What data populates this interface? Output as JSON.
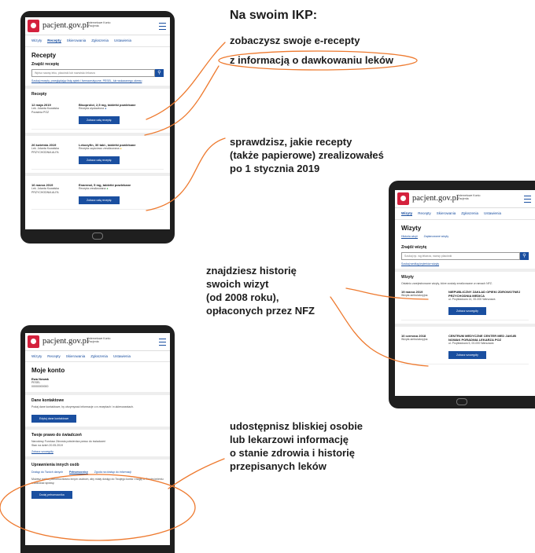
{
  "annotations": {
    "title": "Na swoim IKP:",
    "ann1_line1": "zobaczysz swoje e-recepty",
    "ann1_line2": "z informacją o dawkowaniu leków",
    "ann2": [
      "sprawdzisz, jakie recepty",
      "(także papierowe) zrealizowałeś",
      "po 1 stycznia 2019"
    ],
    "ann3": [
      "znajdziesz historię",
      "swoich wizyt",
      "(od 2008 roku),",
      "opłaconych przez NFZ"
    ],
    "ann4": [
      "udostępnisz bliskiej osobie",
      "lub lekarzowi informację",
      "o stanie zdrowia i historię",
      "przepisanych leków"
    ]
  },
  "site": {
    "brand": "pacjent.gov.pl",
    "brand_sub": "Internetowe Konto Pacjenta",
    "nav": [
      "Wizyty",
      "Recepty",
      "Skierowania",
      "Zgłoszenia",
      "Ustawienia"
    ]
  },
  "recepty": {
    "title": "Recepty",
    "search_label": "Znajdź receptę",
    "search_placeholder": "Wpisz nazwę leku, placówki lub nazwisko lekarza",
    "search_link": "Szukaj recepty, przeglądając listę aptek i farmaceutyczne, PESEL, lub wskazanego okresu",
    "list_title": "Recepty",
    "items": [
      {
        "date": "12 maja 2019",
        "meta1": "Lek. Jolanta Kowalska",
        "meta2": "Poradnia POZ",
        "drug": "Bisoprolol, 2,5 mg, tabletki powlekane",
        "status": "Recepta wystawiona",
        "button": "Zobacz całą receptę"
      },
      {
        "date": "26 kwietnia 2019",
        "meta1": "Lek. Jolanta Kowalska",
        "meta2": "PRZYCHODNIA ALFA",
        "drug": "Lekoxyfin, 30 tabl., tabletki powlekane",
        "status": "Recepta częściowo zrealizowana",
        "button": "Zobacz całą receptę"
      },
      {
        "date": "16 marca 2019",
        "meta1": "Lek. Jolanta Kowalska",
        "meta2": "PRZYCHODNIA ALFA",
        "drug": "Enarenal, 5 mg, tabletki powlekane",
        "status": "Recepta zrealizowana",
        "button": "Zobacz całą receptę"
      }
    ]
  },
  "wizyty": {
    "title": "Wizyty",
    "tabs": [
      "Historia wizyt",
      "Zaplanowane wizyty"
    ],
    "search_label": "Znajdź wizytę",
    "search_placeholder": "Szukaj np. wg lekarza, nazwy placówki",
    "search_link": "Szukaj według kryteriów wizyty",
    "list_title": "Wizyty",
    "list_desc": "Ostatnio zarejestrowane wizyty, które zostały zrealizowane w ramach NFZ.",
    "items": [
      {
        "date": "19 marca 2019",
        "type": "Wizyta ambulatoryjna",
        "place": "NIEPUBLICZNY ZAKŁAD OPIEKI ZDROWOTNEJ PRZYCHODNIA MEDICA",
        "addr": "ul. Przykładowa 14, 00-000 Warszawa",
        "button": "Zobacz szczegóły"
      },
      {
        "date": "10 czerwca 2018",
        "type": "Wizyta ambulatoryjna",
        "place": "CENTRUM MEDYCZNE CENTER MED JAKUB NOWAK PORADNIA LEKARZA POZ",
        "addr": "ul. Przykładowa 5, 00-000 Warszawa",
        "button": "Zobacz szczegóły"
      }
    ]
  },
  "konto": {
    "title": "Moje konto",
    "user_name": "Ewa Nowak",
    "user_label": "PESEL",
    "user_pesel": "00000000000",
    "contact_title": "Dane kontaktowe",
    "contact_desc": "Podaj dane kontaktowe, by otrzymywać informacje o e-receptach i e-skierowaniach.",
    "contact_button": "Edytuj dane kontaktowe",
    "rights_title": "Twoje prawo do świadczeń",
    "rights_desc": "Narodowy Fundusz Zdrowia potwierdza prawo do świadczeń",
    "rights_date": "Stan na dzień 20.05.2019",
    "rights_link": "Zobacz szczegóły",
    "perm_title": "Uprawnienia innych osób",
    "perm_tabs": [
      "Dostęp do Twoich danych",
      "Pełnomocnicy",
      "Zgoda na dostęp do informacji"
    ],
    "perm_desc": "Możesz nadać pełnomocnictwo innym osobom, aby miały dostęp do Twojego konta i mogły w Twoim imieniu realizować sprawy.",
    "perm_button": "Dodaj pełnomocnika"
  }
}
